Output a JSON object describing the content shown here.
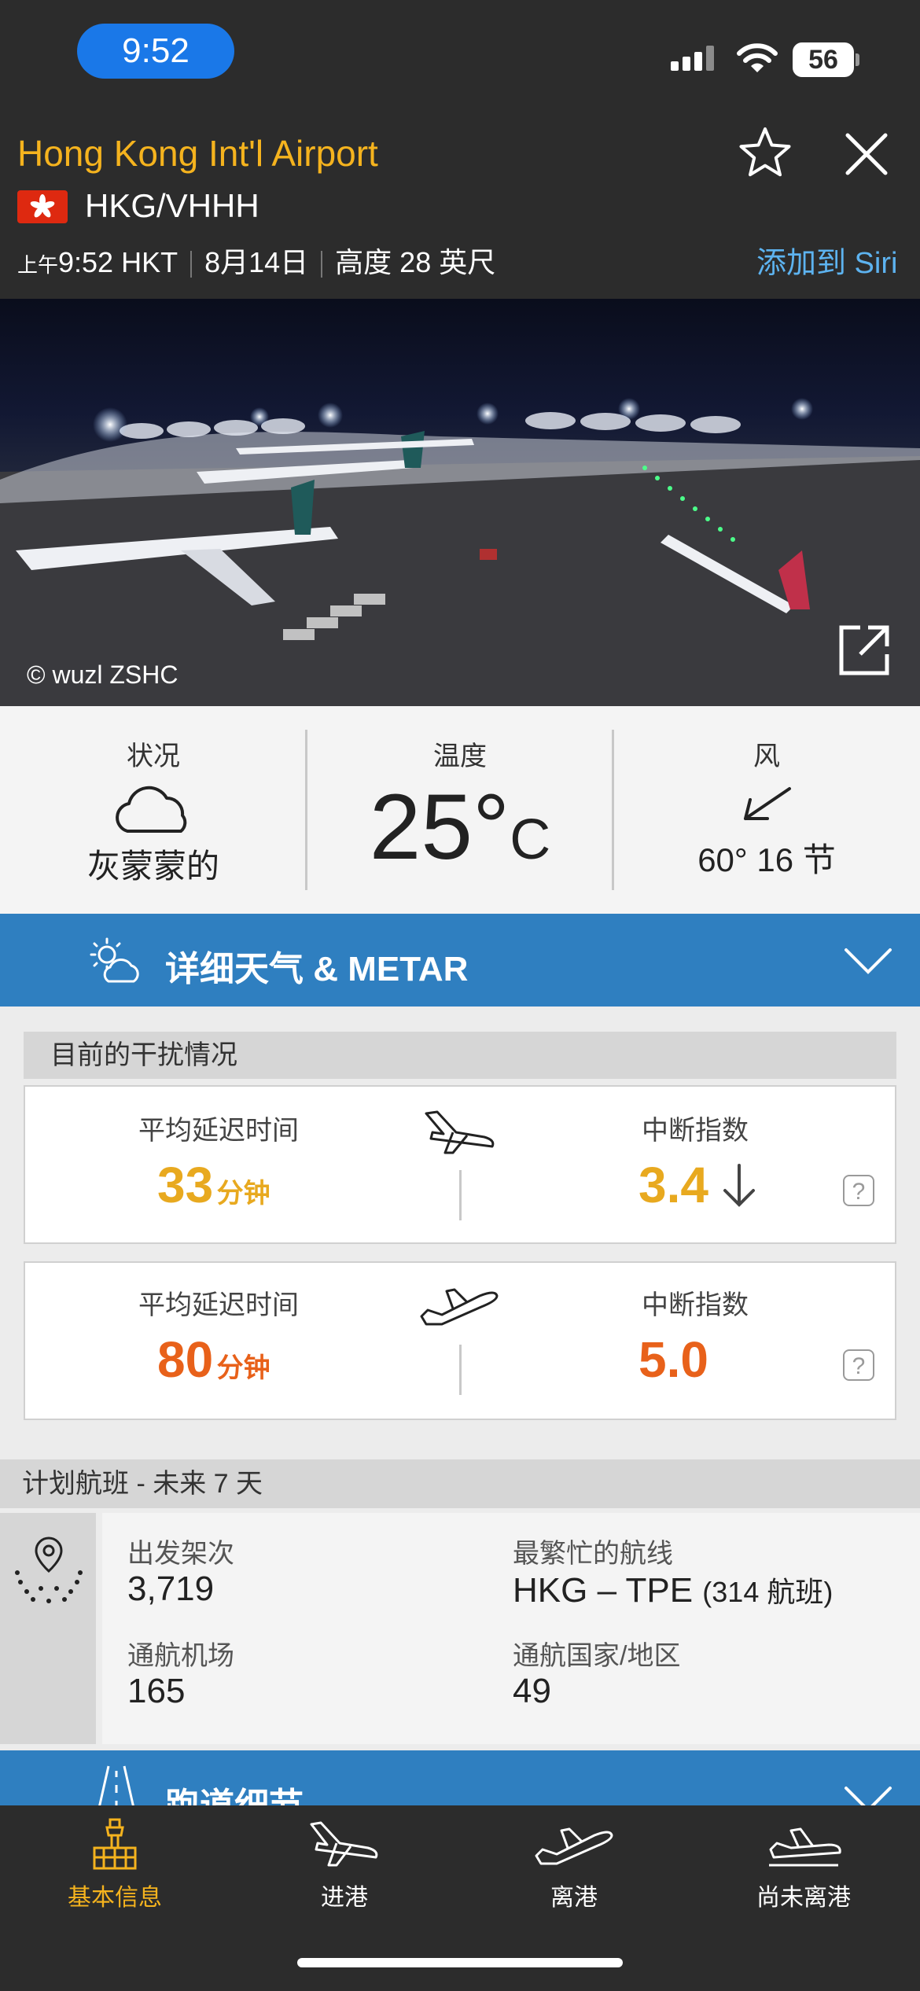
{
  "status_bar": {
    "time": "9:52",
    "battery": "56"
  },
  "airport": {
    "name": "Hong Kong Int'l Airport",
    "codes": "HKG/VHHH",
    "time_prefix": "上午",
    "time": "9:52 HKT",
    "date": "8月14日",
    "elevation": "高度 28 英尺",
    "siri_link": "添加到 Siri"
  },
  "photo": {
    "credit": "© wuzl ZSHC"
  },
  "weather": {
    "condition_label": "状况",
    "condition_value": "灰蒙蒙的",
    "temperature_label": "温度",
    "temperature_value": "25°",
    "temperature_unit": "C",
    "wind_label": "风",
    "wind_value": "60° 16 节",
    "details_bar": "详细天气 & METAR"
  },
  "disruption": {
    "header": "目前的干扰情况",
    "arrivals": {
      "delay_label": "平均延迟时间",
      "delay_value": "33",
      "delay_unit": "分钟",
      "index_label": "中断指数",
      "index_value": "3.4",
      "trend": "down",
      "color": "#e8a91f"
    },
    "departures": {
      "delay_label": "平均延迟时间",
      "delay_value": "80",
      "delay_unit": "分钟",
      "index_label": "中断指数",
      "index_value": "5.0",
      "color": "#e8611a"
    },
    "help_glyph": "?"
  },
  "planned": {
    "header": "计划航班 - 未来 7 天",
    "departures_label": "出发架次",
    "departures_value": "3,719",
    "busiest_label": "最繁忙的航线",
    "busiest_route": "HKG – TPE",
    "busiest_count": "(314 航班)",
    "airports_label": "通航机场",
    "airports_value": "165",
    "countries_label": "通航国家/地区",
    "countries_value": "49"
  },
  "runway_bar": {
    "label": "跑道细节"
  },
  "tabs": [
    {
      "label": "基本信息",
      "icon": "airport-tower-icon",
      "active": true
    },
    {
      "label": "进港",
      "icon": "arrival-plane-icon",
      "active": false
    },
    {
      "label": "离港",
      "icon": "departure-plane-icon",
      "active": false
    },
    {
      "label": "尚未离港",
      "icon": "plane-on-ground-icon",
      "active": false
    }
  ],
  "colors": {
    "accent": "#f5b31e",
    "bar_blue": "#2f7fc0",
    "siri": "#5db3f0"
  }
}
